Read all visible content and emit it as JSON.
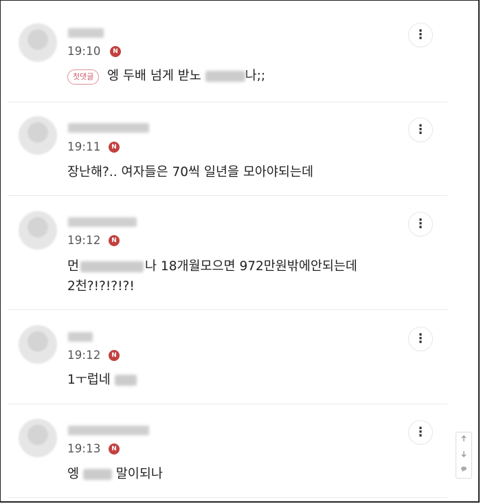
{
  "comments": [
    {
      "time": "19:10",
      "badge": "N",
      "first_comment_label": "첫댓글",
      "text_before": "엥 두배 넘게 받노 ",
      "text_after": "나;;"
    },
    {
      "time": "19:11",
      "badge": "N",
      "text": "장난해?.. 여자들은 70씩 일년을 모아야되는데"
    },
    {
      "time": "19:12",
      "badge": "N",
      "text_line1_before": "먼",
      "text_line1_after": "나 18개월모으면 972만원밖에안되는데",
      "text_line2": "2천?!?!?!?!"
    },
    {
      "time": "19:12",
      "badge": "N",
      "text": "1ㅜ럽네 "
    },
    {
      "time": "19:13",
      "badge": "N",
      "text_before": "엥 ",
      "text_after": " 말이되나"
    }
  ],
  "more_icon": "vertical-dots-icon",
  "more_glyph": "⋮",
  "scroll_widget": {
    "up_icon": "arrow-up-icon",
    "down_icon": "arrow-down-icon",
    "comment_icon": "comment-bubble-icon"
  },
  "colors": {
    "badge_red": "#c2413f",
    "first_comment_border": "#e0909a",
    "time_gray": "#555555",
    "divider": "#e9e9e9"
  }
}
